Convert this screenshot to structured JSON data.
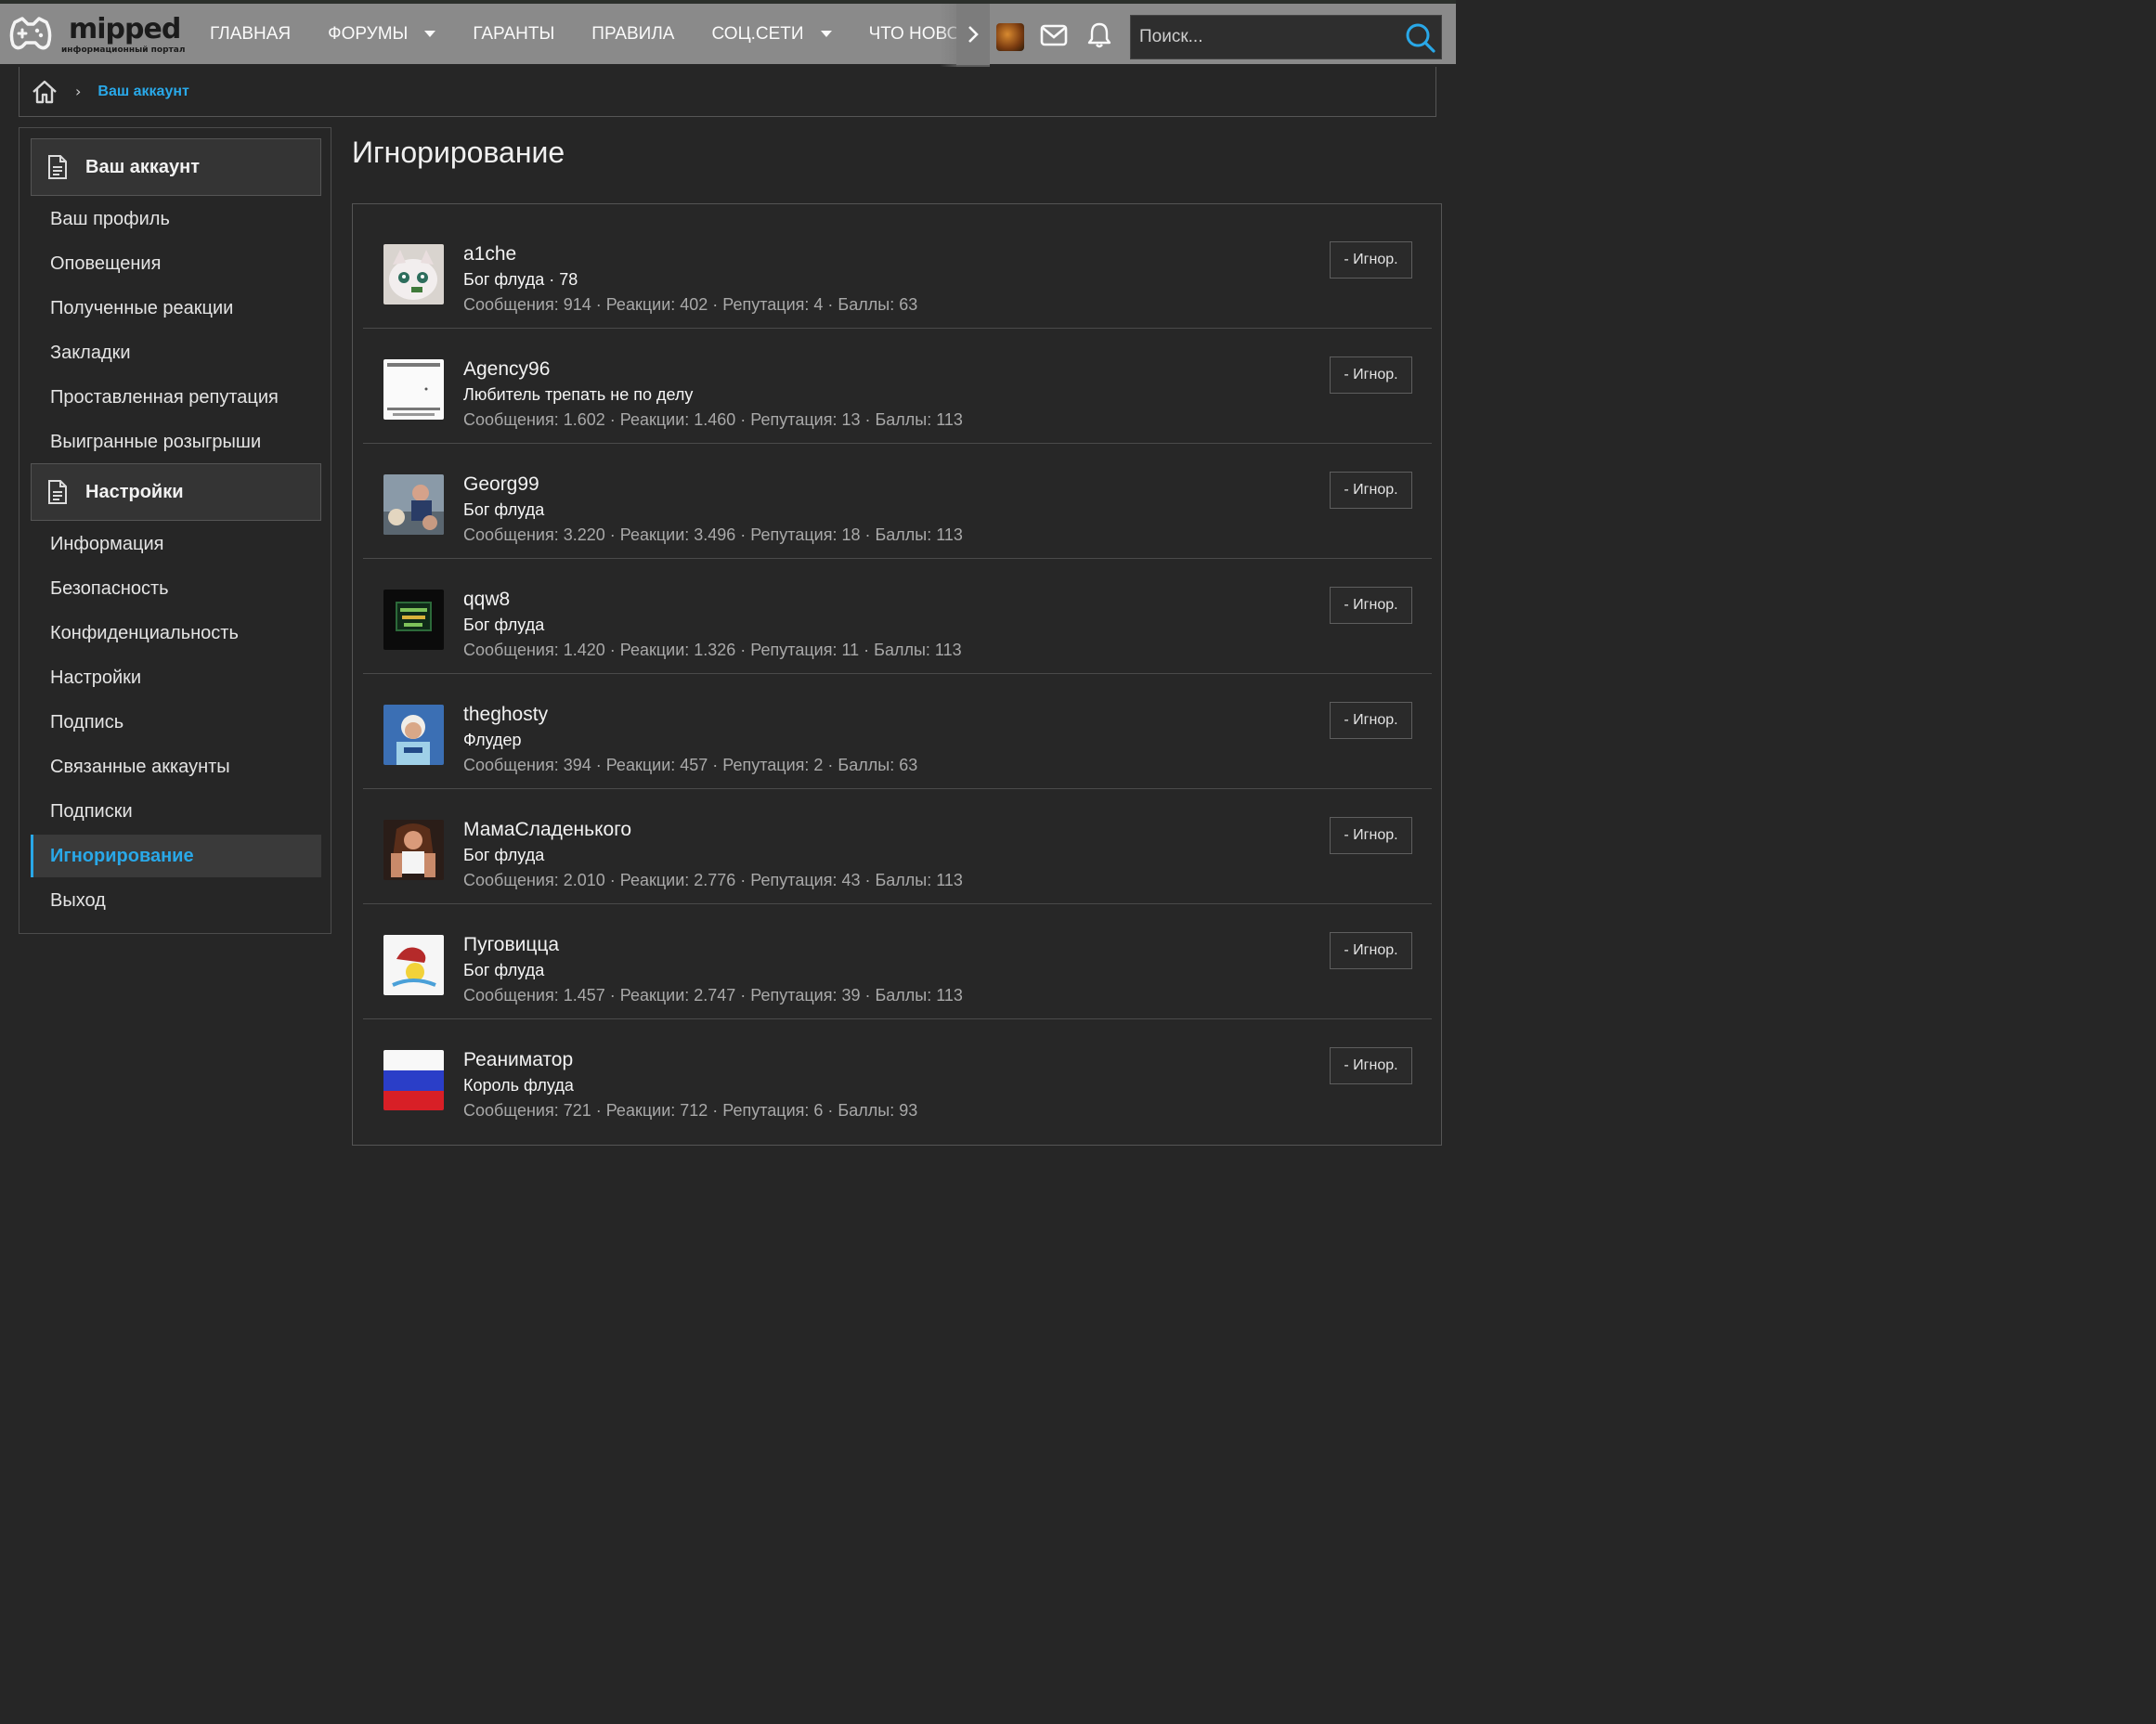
{
  "brand": {
    "name": "mipped",
    "tagline": "информационный портал"
  },
  "nav": [
    {
      "label": "ГЛАВНАЯ",
      "dropdown": false
    },
    {
      "label": "ФОРУМЫ",
      "dropdown": true
    },
    {
      "label": "ГАРАНТЫ",
      "dropdown": false
    },
    {
      "label": "ПРАВИЛА",
      "dropdown": false
    },
    {
      "label": "СОЦ.СЕТИ",
      "dropdown": true
    },
    {
      "label": "ЧТО НОВО",
      "dropdown": false
    }
  ],
  "search": {
    "placeholder": "Поиск..."
  },
  "breadcrumb": {
    "current": "Ваш аккаунт"
  },
  "sidebar": {
    "section1": "Ваш аккаунт",
    "items1": [
      "Ваш профиль",
      "Оповещения",
      "Полученные реакции",
      "Закладки",
      "Проставленная репутация",
      "Выигранные розыгрыши"
    ],
    "section2": "Настройки",
    "items2": [
      "Информация",
      "Безопасность",
      "Конфиденциальность",
      "Настройки",
      "Подпись",
      "Связанные аккаунты",
      "Подписки",
      "Игнорирование",
      "Выход"
    ]
  },
  "page": {
    "title": "Игнорирование"
  },
  "ignore_button_label": "- Игнор.",
  "users": [
    {
      "name": "a1che",
      "title": "Бог флуда · 78",
      "stats": "Сообщения: 914 · Реакции: 402 · Репутация: 4 · Баллы: 63"
    },
    {
      "name": "Agency96",
      "title": "Любитель трепать не по делу",
      "stats": "Сообщения: 1.602 · Реакции: 1.460 · Репутация: 13 · Баллы: 113"
    },
    {
      "name": "Georg99",
      "title": "Бог флуда",
      "stats": "Сообщения: 3.220 · Реакции: 3.496 · Репутация: 18 · Баллы: 113"
    },
    {
      "name": "qqw8",
      "title": "Бог флуда",
      "stats": "Сообщения: 1.420 · Реакции: 1.326 · Репутация: 11 · Баллы: 113"
    },
    {
      "name": "theghosty",
      "title": "Флудер",
      "stats": "Сообщения: 394 · Реакции: 457 · Репутация: 2 · Баллы: 63"
    },
    {
      "name": "МамаСладенького",
      "title": "Бог флуда",
      "stats": "Сообщения: 2.010 · Реакции: 2.776 · Репутация: 43 · Баллы: 113"
    },
    {
      "name": "Пуговицца",
      "title": "Бог флуда",
      "stats": "Сообщения: 1.457 · Реакции: 2.747 · Репутация: 39 · Баллы: 113"
    },
    {
      "name": "Реаниматор",
      "title": "Король флуда",
      "stats": "Сообщения: 721 · Реакции: 712 · Репутация: 6 · Баллы: 93"
    }
  ],
  "colors": {
    "accent": "#29a8e8",
    "header_bg": "#8a8a8a",
    "page_bg": "#262626"
  }
}
